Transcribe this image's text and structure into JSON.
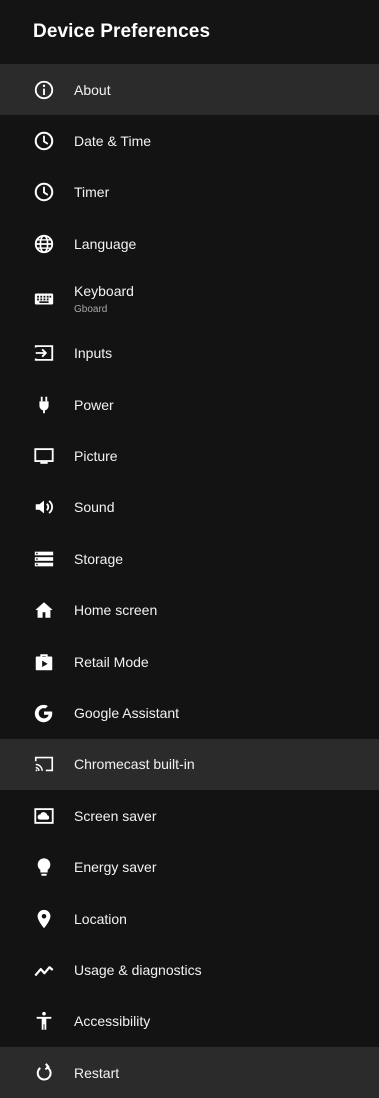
{
  "header": {
    "title": "Device Preferences"
  },
  "menu": {
    "about": "About",
    "date_time": "Date & Time",
    "timer": "Timer",
    "language": "Language",
    "keyboard": "Keyboard",
    "keyboard_sub": "Gboard",
    "inputs": "Inputs",
    "power": "Power",
    "picture": "Picture",
    "sound": "Sound",
    "storage": "Storage",
    "home_screen": "Home screen",
    "retail_mode": "Retail Mode",
    "google_assistant": "Google Assistant",
    "chromecast": "Chromecast built-in",
    "screen_saver": "Screen saver",
    "energy_saver": "Energy saver",
    "location": "Location",
    "usage_diagnostics": "Usage & diagnostics",
    "accessibility": "Accessibility",
    "restart": "Restart"
  },
  "colors": {
    "background": "#131313",
    "highlight": "#2b2b2b",
    "text": "#f2f2f2",
    "subtext": "#a8a8a8"
  }
}
